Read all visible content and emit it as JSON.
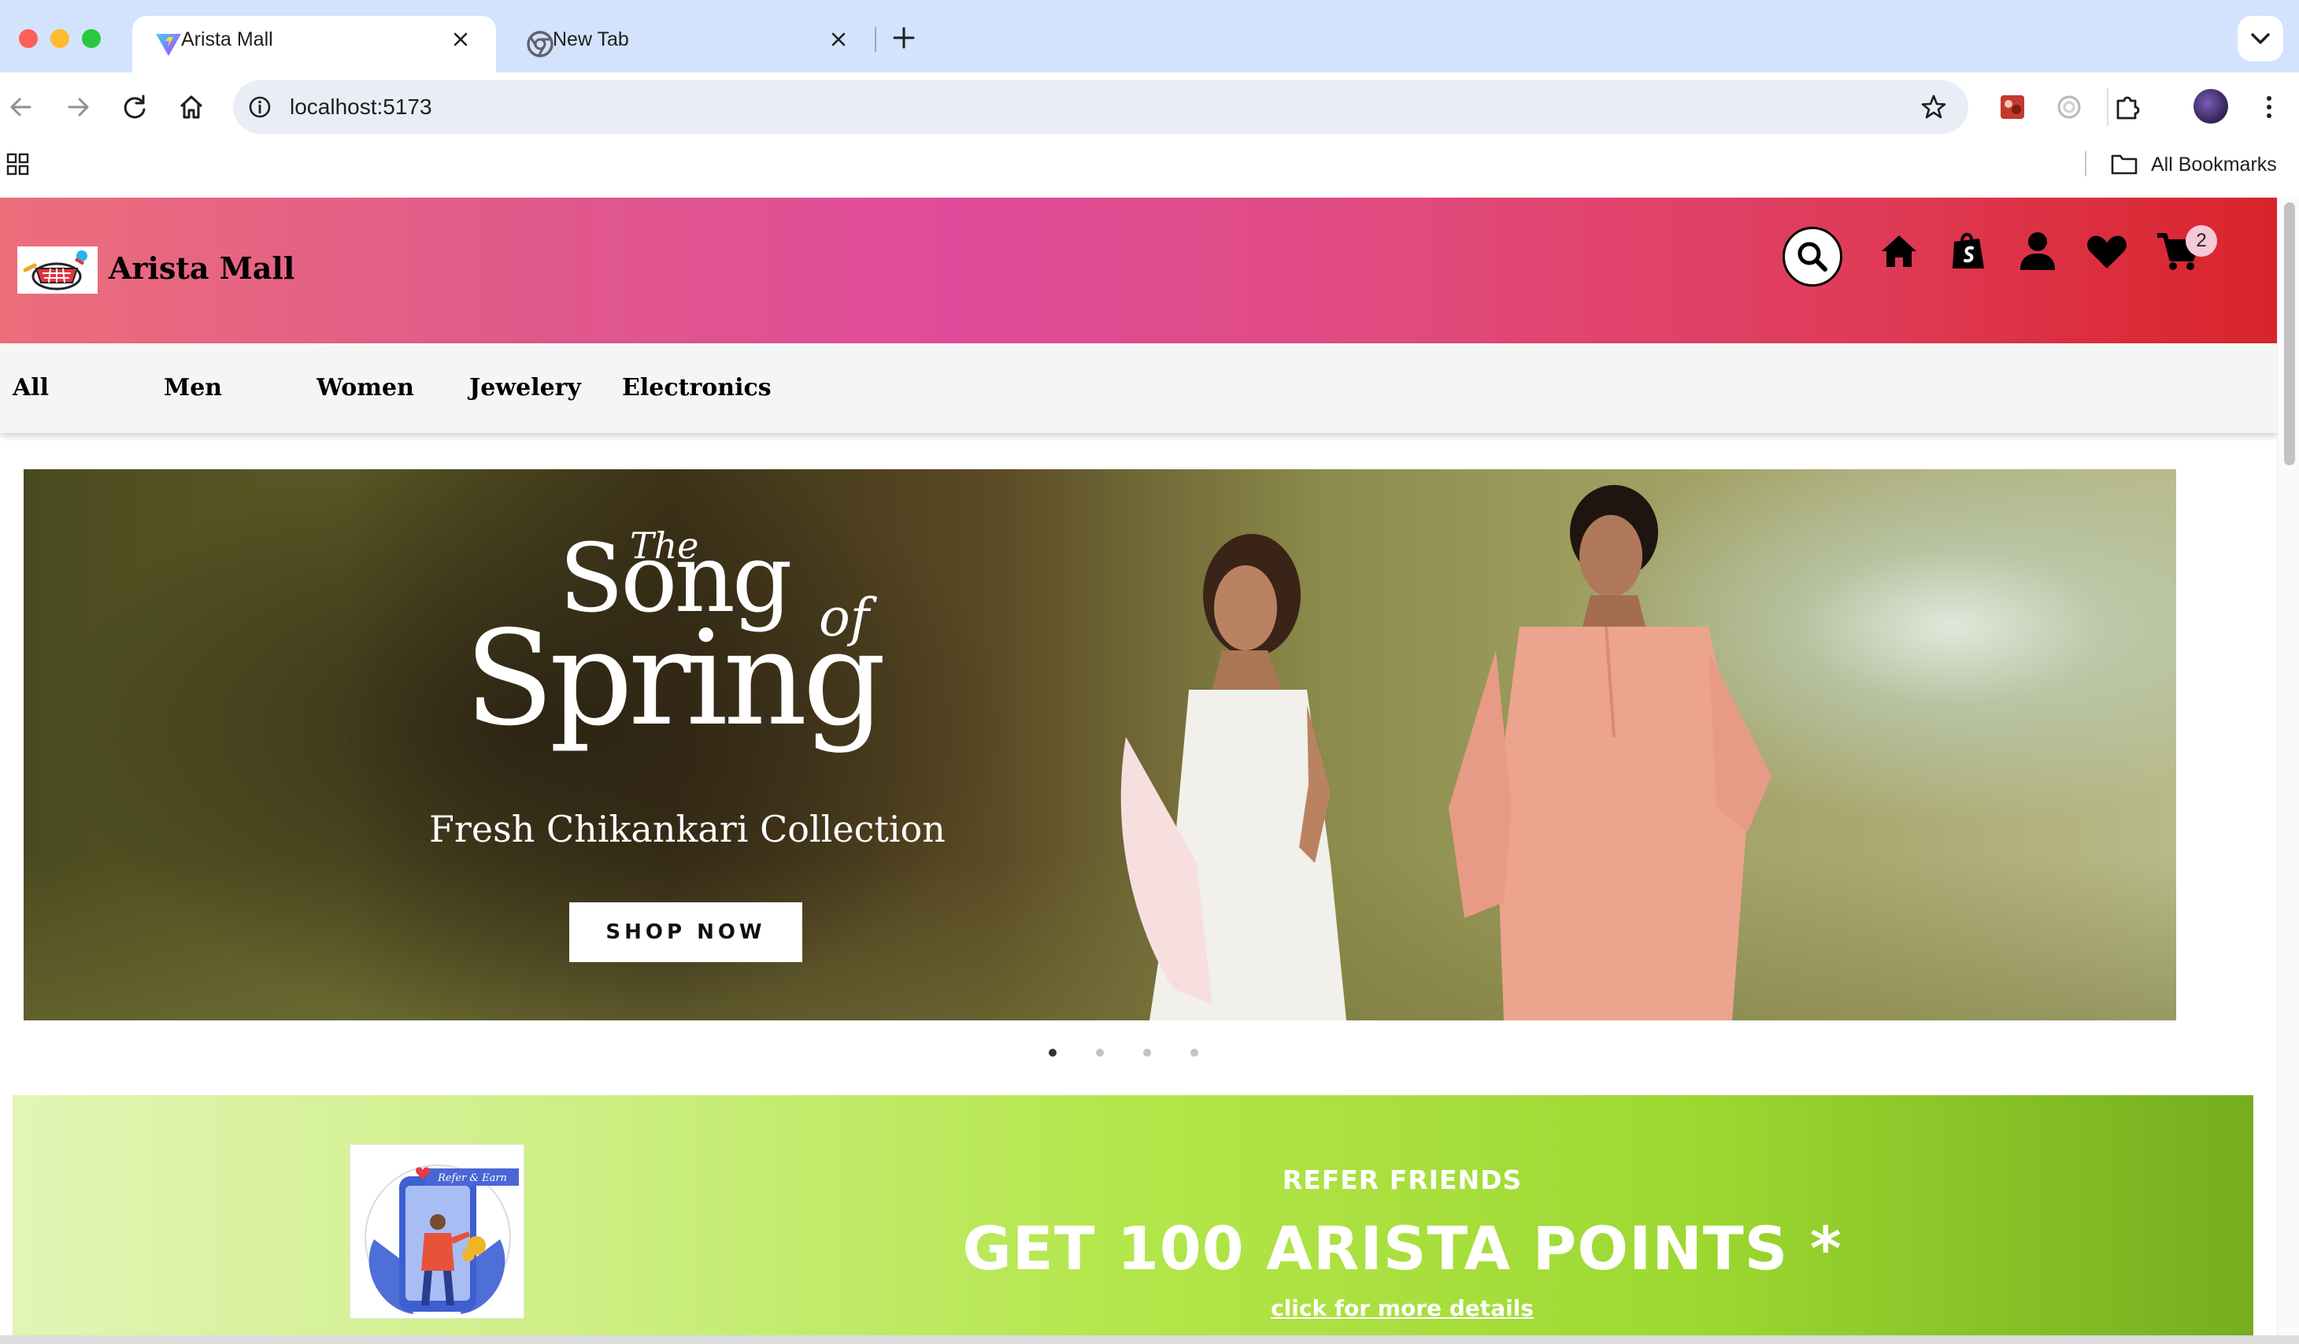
{
  "browser": {
    "tabs": [
      {
        "title": "Arista Mall",
        "active": true,
        "icon": "vite-logo-icon"
      },
      {
        "title": "New Tab",
        "active": false,
        "icon": "chrome-logo-icon"
      }
    ],
    "url": "localhost:5173",
    "bookmarks_bar": {
      "all_bookmarks_label": "All Bookmarks"
    }
  },
  "site": {
    "brand": {
      "name": "Arista Mall",
      "logo_icon": "shopping-basket-logo"
    },
    "header_icons": [
      "search-icon",
      "home-icon",
      "shopify-bag-icon",
      "user-icon",
      "heart-icon",
      "cart-icon"
    ],
    "cart_count": "2",
    "header_gradient": [
      "#ec6e7b",
      "#e04c9b",
      "#d9242a"
    ]
  },
  "categories": [
    "All",
    "Men",
    "Women",
    "Jewelery",
    "Electronics"
  ],
  "hero": {
    "headline_the": "The",
    "headline_song": "Song",
    "headline_of": "of",
    "headline_spring": "Spring",
    "subtitle": "Fresh Chikankari Collection",
    "cta": "SHOP NOW",
    "slide_count": 4,
    "active_slide": 1
  },
  "referral": {
    "image_caption": "Refer & Earn",
    "eyebrow": "REFER FRIENDS",
    "headline": "GET 100 ARISTA POINTS *",
    "link": "click for more details",
    "gradient": [
      "#e2f5b5",
      "#b3e64a",
      "#75ae1f"
    ]
  }
}
